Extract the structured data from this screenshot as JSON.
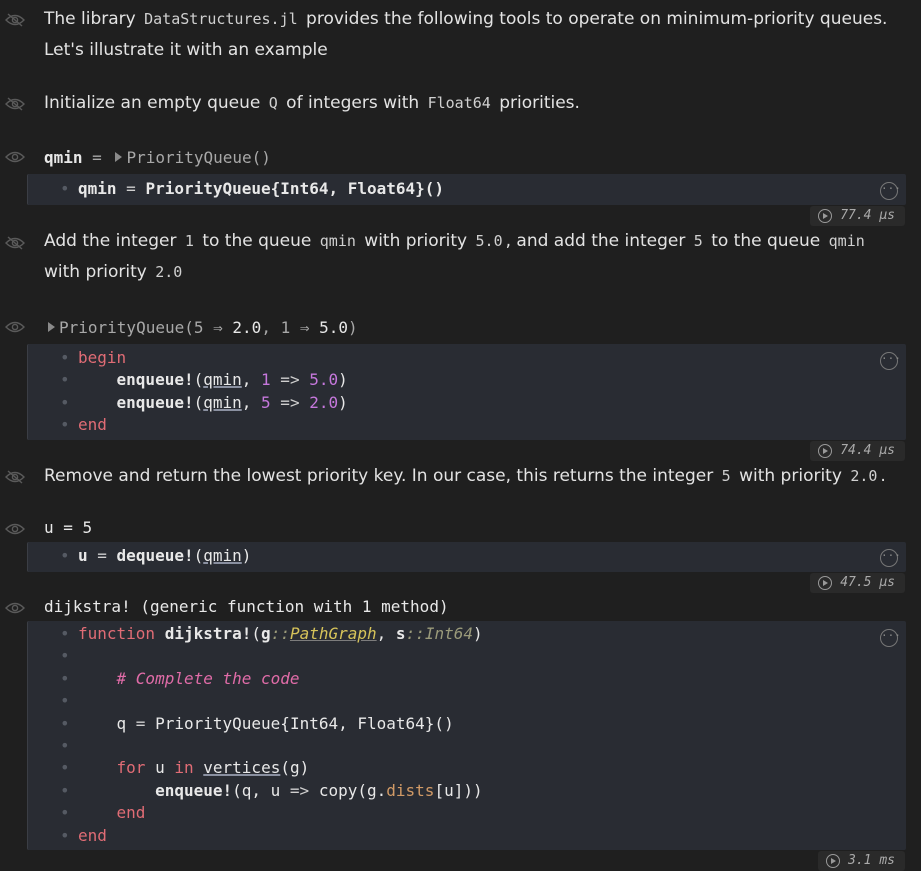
{
  "md1": {
    "pre": "The library ",
    "code": "DataStructures.jl",
    "post": " provides the following tools to operate on minimum-priority queues.",
    "line2": "Let's illustrate it with an example"
  },
  "md2": {
    "pre": "Initialize an empty queue ",
    "code1": "Q",
    "mid": " of integers with ",
    "code2": "Float64",
    "post": " priorities."
  },
  "out1": {
    "name": "qmin",
    "eq": " = ",
    "value": "PriorityQueue()"
  },
  "code1": {
    "line1_var": "qmin",
    "line1_eq": " = ",
    "line1_type": "PriorityQueue{Int64, Float64}()"
  },
  "time1": "77.4 μs",
  "md3": {
    "t1": "Add the integer ",
    "c1": "1",
    "t2": " to the queue ",
    "c2": "qmin",
    "t3": " with priority ",
    "c3": "5.0",
    "t4": ", and add the integer ",
    "c4": "5",
    "t5": " to the queue ",
    "c5": "qmin",
    "t6": "with priority ",
    "c6": "2.0"
  },
  "out2": {
    "pre": "PriorityQueue(",
    "k1": "5",
    "v1": "2.0",
    "k2": "1",
    "v2": "5.0",
    "arrow": " ⇒ ",
    "sep": ", ",
    "close": ")"
  },
  "code2": {
    "begin": "begin",
    "fn": "enqueue!",
    "arg": "qmin",
    "arrow": " => ",
    "k1": "1",
    "v1": "5.0",
    "k2": "5",
    "v2": "2.0",
    "end": "end"
  },
  "time2": "74.4 μs",
  "md4": {
    "t1": "Remove and return the lowest priority key. In our case, this returns the integer ",
    "c1": "5",
    "t2": " with priority ",
    "c2": "2.0",
    "t3": "."
  },
  "out3": {
    "text": "u = 5"
  },
  "code3": {
    "var": "u",
    "eq": " = ",
    "fn": "dequeue!",
    "arg": "qmin"
  },
  "time3": "47.5 μs",
  "out4": {
    "text": "dijkstra! (generic function with 1 method)"
  },
  "code4": {
    "kw_function": "function",
    "fname": "dijkstra!",
    "g": "g",
    "g_type": "PathGraph",
    "s": "s",
    "s_type": "Int64",
    "comment": "# Complete the code",
    "q": "q",
    "pq": "PriorityQueue{Int64, Float64}()",
    "kw_for": "for",
    "u": "u",
    "kw_in": "in",
    "vertices": "vertices",
    "enqueue": "enqueue!",
    "copy": "copy",
    "dists": "dists",
    "kw_end": "end"
  },
  "time4": "3.1 ms"
}
